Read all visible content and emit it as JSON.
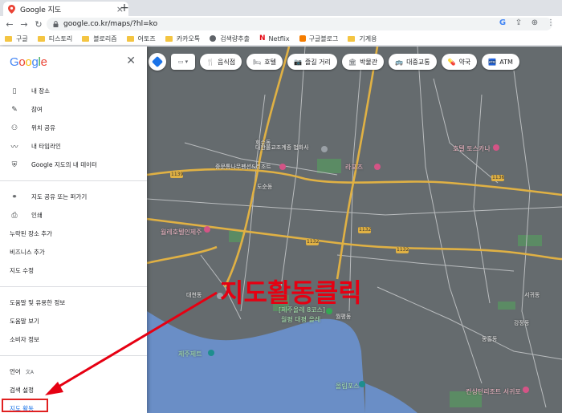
{
  "browser": {
    "tab_title": "Google 지도",
    "tab_close": "×",
    "new_tab": "+",
    "url": "google.co.kr/maps/?hl=ko",
    "nav": {
      "back": "←",
      "forward": "→",
      "reload": "↻"
    },
    "omni_icons": [
      "G",
      "⇪",
      "⊕",
      "⋮"
    ]
  },
  "bookmarks": [
    {
      "label": "구글",
      "icon": "folder"
    },
    {
      "label": "티스토리",
      "icon": "folder"
    },
    {
      "label": "블로리즘",
      "icon": "folder"
    },
    {
      "label": "어토즈",
      "icon": "folder"
    },
    {
      "label": "카카오톡",
      "icon": "folder"
    },
    {
      "label": "검색량추출",
      "icon": "globe"
    },
    {
      "label": "Netflix",
      "icon": "netflix"
    },
    {
      "label": "구글블로그",
      "icon": "blogger"
    },
    {
      "label": "기계용",
      "icon": "folder"
    }
  ],
  "map_controls": {
    "layer": "▭ ▾",
    "buttons": [
      {
        "icon": "🍴",
        "label": "음식점"
      },
      {
        "icon": "🛏",
        "label": "호텔"
      },
      {
        "icon": "📷",
        "label": "즐길 거리"
      },
      {
        "icon": "🏛",
        "label": "박물관"
      },
      {
        "icon": "🚌",
        "label": "대중교통"
      },
      {
        "icon": "💊",
        "label": "약국"
      },
      {
        "icon": "🏧",
        "label": "ATM"
      }
    ]
  },
  "menu": {
    "logo": [
      "G",
      "o",
      "o",
      "g",
      "l",
      "e"
    ],
    "close": "✕",
    "section1": [
      {
        "icon": "bookmark-icon",
        "glyph": "▯",
        "label": "내 장소"
      },
      {
        "icon": "contribute-icon",
        "glyph": "✎",
        "label": "참여"
      },
      {
        "icon": "location-share-icon",
        "glyph": "⚇",
        "label": "위치 공유"
      },
      {
        "icon": "timeline-icon",
        "glyph": "〰",
        "label": "내 타임라인"
      },
      {
        "icon": "shield-icon",
        "glyph": "⛨",
        "label": "Google 지도의 내 데이터"
      }
    ],
    "section2": [
      {
        "icon": "link-icon",
        "glyph": "⚭",
        "label": "지도 공유 또는 퍼가기"
      },
      {
        "icon": "print-icon",
        "glyph": "⎙",
        "label": "인쇄"
      },
      {
        "label": "누락된 장소 추가"
      },
      {
        "label": "비즈니스 추가"
      },
      {
        "label": "지도 수정"
      }
    ],
    "section3": [
      {
        "label": "도움말 및 유용한 정보"
      },
      {
        "label": "도움말 보기"
      },
      {
        "label": "소비자 정보"
      }
    ],
    "section4": [
      {
        "label": "언어",
        "suffix": "文A"
      },
      {
        "label": "검색 설정"
      },
      {
        "label": "지도 활동"
      }
    ]
  },
  "map_labels": {
    "temple": "대한불교조계종 법화사",
    "jungmun": "중문통나무펜션&리조트",
    "lapo": "라포즈",
    "hotel_toscana": "호텔 토스카나",
    "hotel_jeju": "월레호텔인제주",
    "jeju_olle": "[제주올레 8코스]",
    "yakcheonsa": "월평 대평 올레",
    "daecheon": "대천동",
    "jeju_ocean": "제주제트",
    "wolpyeong": "올림포스",
    "city_resort": "컨싱턴리조트 서귀포",
    "road_1139": "1139",
    "road_1136": "1136",
    "road_1132": "1132",
    "hoeso": "회수동",
    "gangjeong": "강정동",
    "seogwi": "서귀동",
    "donghong": "동홍동",
    "woljeong": "월평동",
    "dosun": "도순동"
  },
  "annotation": {
    "text": "지도활동클릭"
  },
  "colors": {
    "map_bg": "#656b6e",
    "road_yellow": "#e0b144",
    "road_white": "#c9ccce",
    "sea": "#6a8ec6",
    "green": "#5b8b64",
    "annotation_red": "#e60012"
  }
}
